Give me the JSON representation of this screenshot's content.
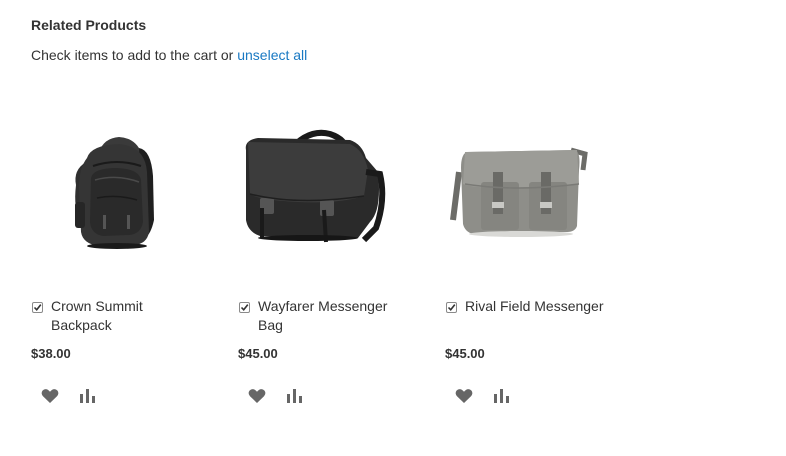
{
  "block": {
    "title": "Related Products",
    "actions_text": "Check items to add to the cart or",
    "unselect_label": "unselect all"
  },
  "products": [
    {
      "name": "Crown Summit Backpack",
      "price": "$38.00",
      "checked": true,
      "image": "backpack-image"
    },
    {
      "name": "Wayfarer Messenger Bag",
      "price": "$45.00",
      "checked": true,
      "image": "messenger-bag-image"
    },
    {
      "name": "Rival Field Messenger",
      "price": "$45.00",
      "checked": true,
      "image": "field-messenger-image"
    }
  ],
  "icons": {
    "wishlist": "heart-icon",
    "compare": "compare-icon"
  },
  "colors": {
    "link": "#1979c3",
    "text": "#333333",
    "icon": "#666666"
  }
}
